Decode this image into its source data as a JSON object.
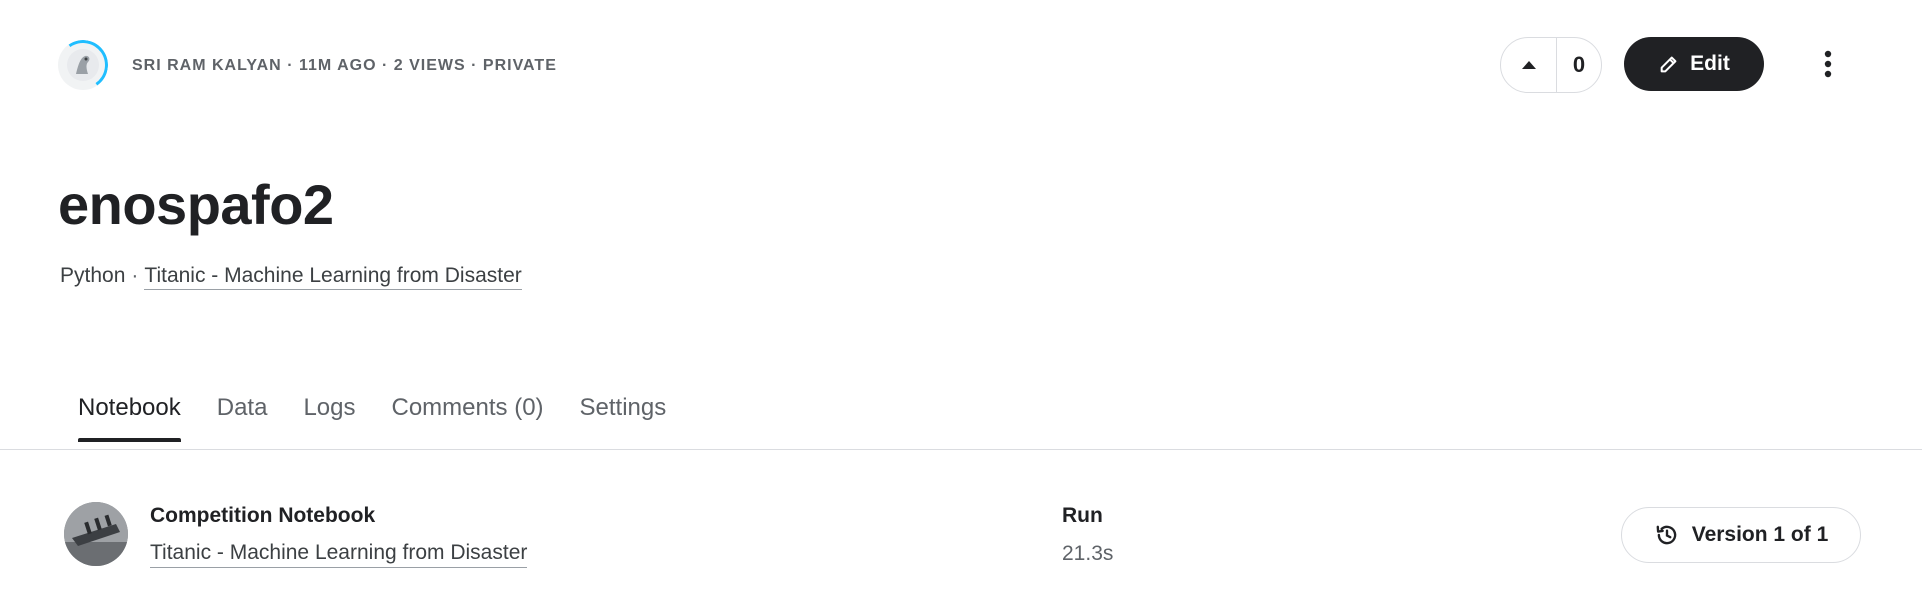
{
  "header": {
    "author": "SRI RAM KALYAN",
    "time": "11M AGO",
    "views": "2 VIEWS",
    "visibility": "PRIVATE",
    "separator": "·",
    "vote_count": "0",
    "edit_label": "Edit",
    "icons": {
      "avatar": "author-avatar",
      "upvote": "caret-up-icon",
      "edit": "pencil-icon",
      "more": "more-vertical-icon"
    }
  },
  "notebook": {
    "title": "enospafo2",
    "language": "Python",
    "separator": "·",
    "competition": "Titanic - Machine Learning from Disaster"
  },
  "tabs": [
    {
      "label": "Notebook",
      "active": true
    },
    {
      "label": "Data",
      "active": false
    },
    {
      "label": "Logs",
      "active": false
    },
    {
      "label": "Comments (0)",
      "active": false
    },
    {
      "label": "Settings",
      "active": false
    }
  ],
  "info": {
    "type_label": "Competition Notebook",
    "competition": "Titanic - Machine Learning from Disaster",
    "run_label": "Run",
    "run_value": "21.3s",
    "version_label": "Version 1 of 1",
    "version_icon": "history-icon"
  },
  "colors": {
    "primary_dark": "#202124",
    "muted_text": "#5f6368",
    "border": "#dadce0",
    "accent": "#20beff"
  }
}
